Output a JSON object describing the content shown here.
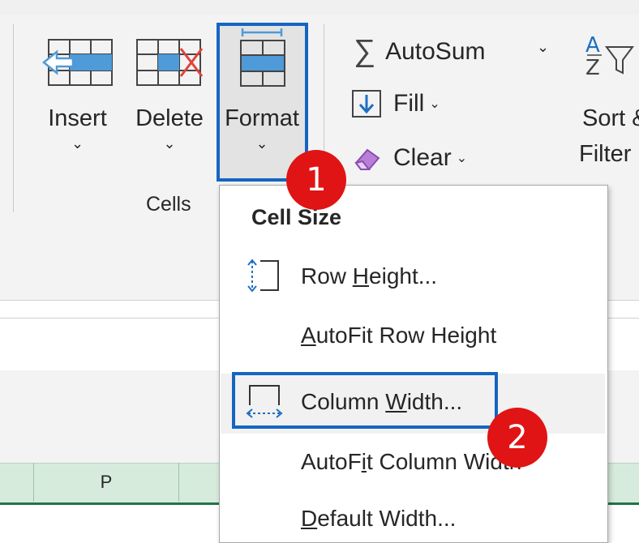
{
  "ribbon": {
    "cells_group": {
      "insert_label": "Insert",
      "delete_label": "Delete",
      "format_label": "Format",
      "group_label": "Cells",
      "chevron": "⌄"
    },
    "editing": {
      "autosum_label": "AutoSum",
      "fill_label": "Fill",
      "clear_label": "Clear",
      "sort_label_line1": "Sort &",
      "sort_label_line2": "Filter",
      "sigma": "∑"
    }
  },
  "sheet": {
    "column_header_p": "P"
  },
  "format_menu": {
    "section_heading": "Cell Size",
    "row_height": {
      "pre": "Row ",
      "key": "H",
      "post": "eight..."
    },
    "autofit_row_height": {
      "pre": "",
      "key": "A",
      "post": "utoFit Row Height"
    },
    "column_width": {
      "pre": "Column ",
      "key": "W",
      "post": "idth..."
    },
    "autofit_column_width": {
      "pre": "AutoF",
      "key": "i",
      "post": "t Column Width"
    },
    "default_width": {
      "pre": "",
      "key": "D",
      "post": "efault Width..."
    }
  },
  "annotations": {
    "step1": "1",
    "step2": "2"
  },
  "colors": {
    "highlight_border": "#1565c0",
    "badge": "#e01414",
    "excel_green": "#217346",
    "icon_blue": "#4f9ad8"
  }
}
